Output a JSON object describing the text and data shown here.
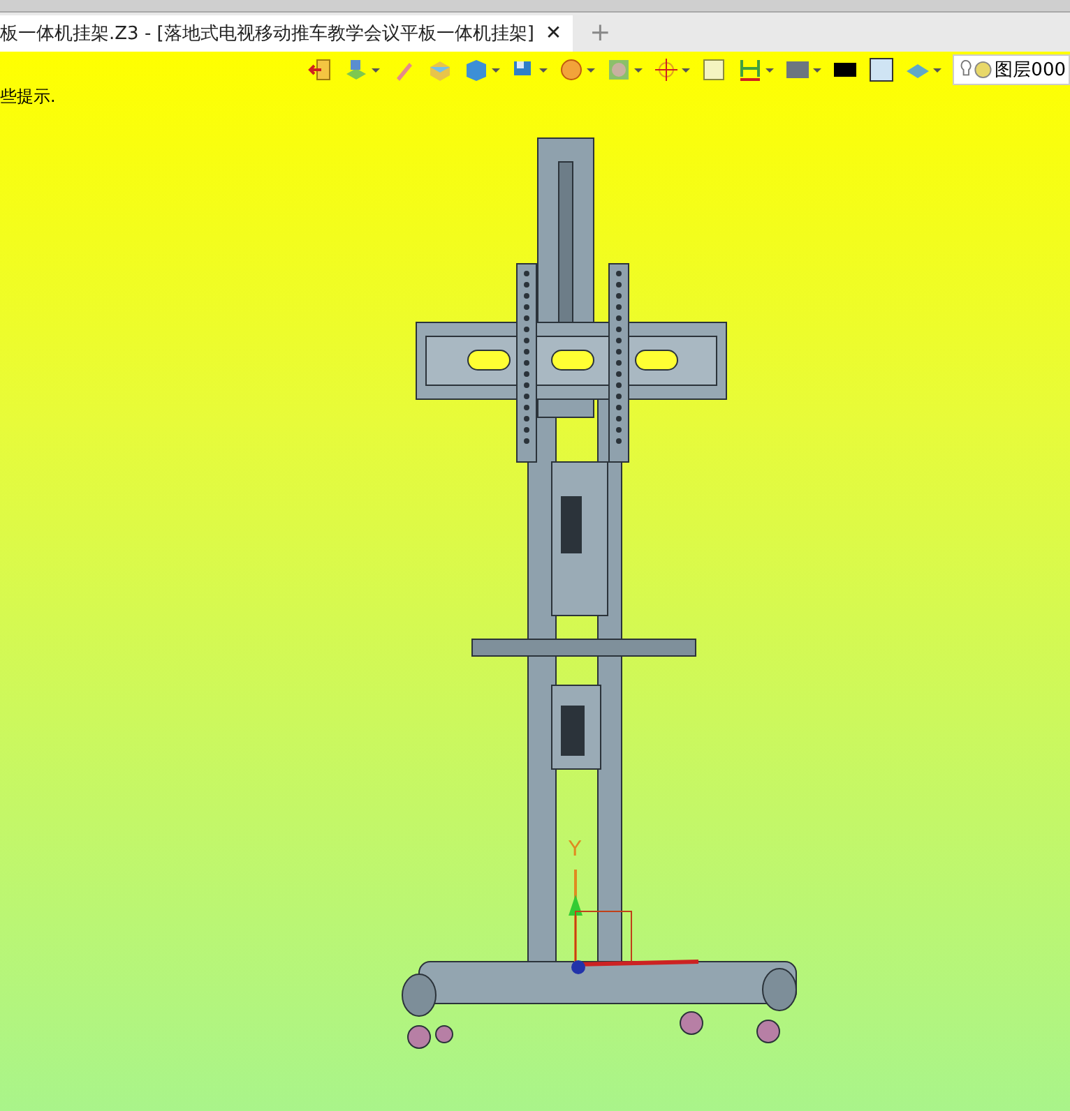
{
  "tabs": [
    {
      "label": "板一体机挂架.Z3 - [落地式电视移动推车教学会议平板一体机挂架]",
      "selected": true,
      "close": "✕"
    }
  ],
  "new_tab": "+",
  "toolbar": {
    "buttons": [
      {
        "kind": "exit",
        "dropdown": false
      },
      {
        "kind": "layers",
        "dropdown": true
      },
      {
        "kind": "pen",
        "dropdown": false
      },
      {
        "kind": "box",
        "dropdown": false
      },
      {
        "kind": "cube",
        "dropdown": true
      },
      {
        "kind": "display",
        "dropdown": true
      },
      {
        "kind": "sphere",
        "dropdown": true
      },
      {
        "kind": "frame",
        "dropdown": true
      },
      {
        "kind": "target",
        "dropdown": true
      },
      {
        "kind": "window",
        "dropdown": false
      },
      {
        "kind": "measure",
        "dropdown": true
      },
      {
        "kind": "monitor",
        "dropdown": true
      },
      {
        "kind": "line",
        "dropdown": false
      },
      {
        "kind": "square",
        "dropdown": false
      },
      {
        "kind": "stack",
        "dropdown": true
      }
    ],
    "layer_field": {
      "value": "图层000"
    }
  },
  "hint": "些提示.",
  "viewport": {
    "axis_label": "Y"
  }
}
